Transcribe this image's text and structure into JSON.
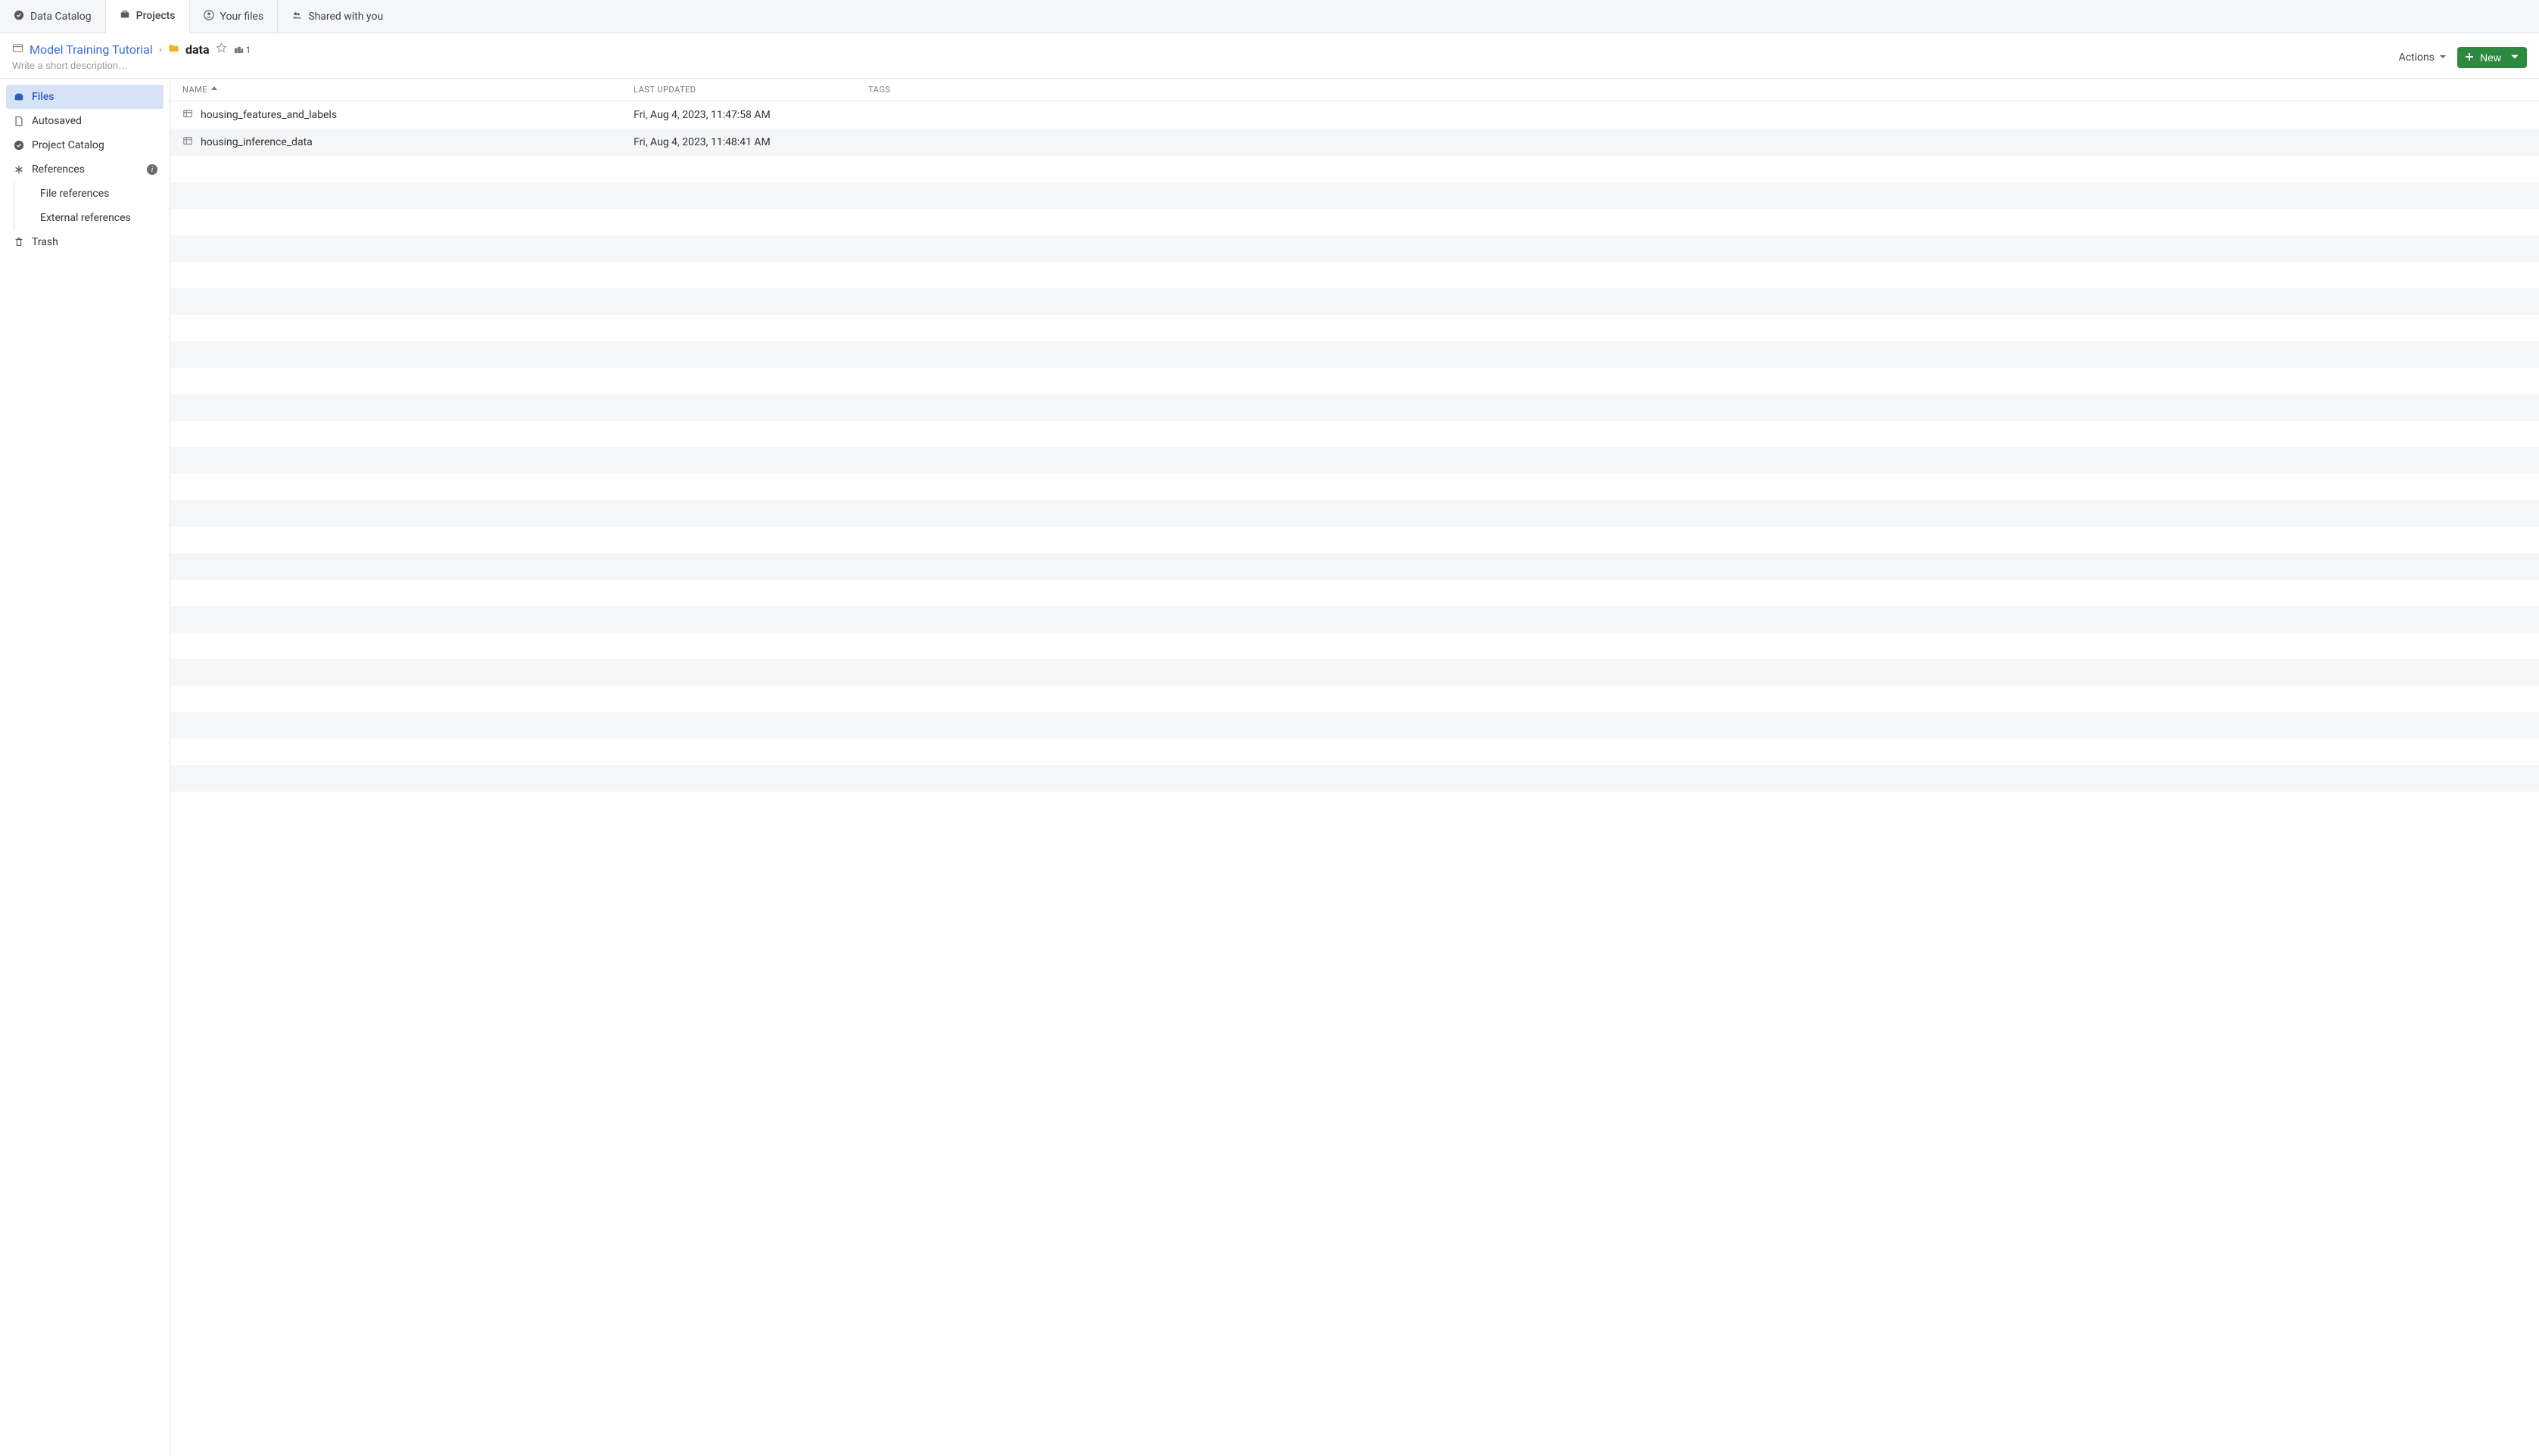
{
  "top_tabs": {
    "data_catalog": "Data Catalog",
    "projects": "Projects",
    "your_files": "Your files",
    "shared": "Shared with you"
  },
  "breadcrumb": {
    "parent": "Model Training Tutorial",
    "current": "data",
    "share_count": "1"
  },
  "description_placeholder": "Write a short description…",
  "actions_label": "Actions",
  "new_label": "New",
  "sidebar": {
    "files": "Files",
    "autosaved": "Autosaved",
    "project_catalog": "Project Catalog",
    "references": "References",
    "file_references": "File references",
    "external_references": "External references",
    "trash": "Trash"
  },
  "table": {
    "col_name": "Name",
    "col_updated": "Last Updated",
    "col_tags": "Tags",
    "rows": [
      {
        "name": "housing_features_and_labels",
        "updated": "Fri, Aug 4, 2023, 11:47:58 AM"
      },
      {
        "name": "housing_inference_data",
        "updated": "Fri, Aug 4, 2023, 11:48:41 AM"
      }
    ]
  }
}
